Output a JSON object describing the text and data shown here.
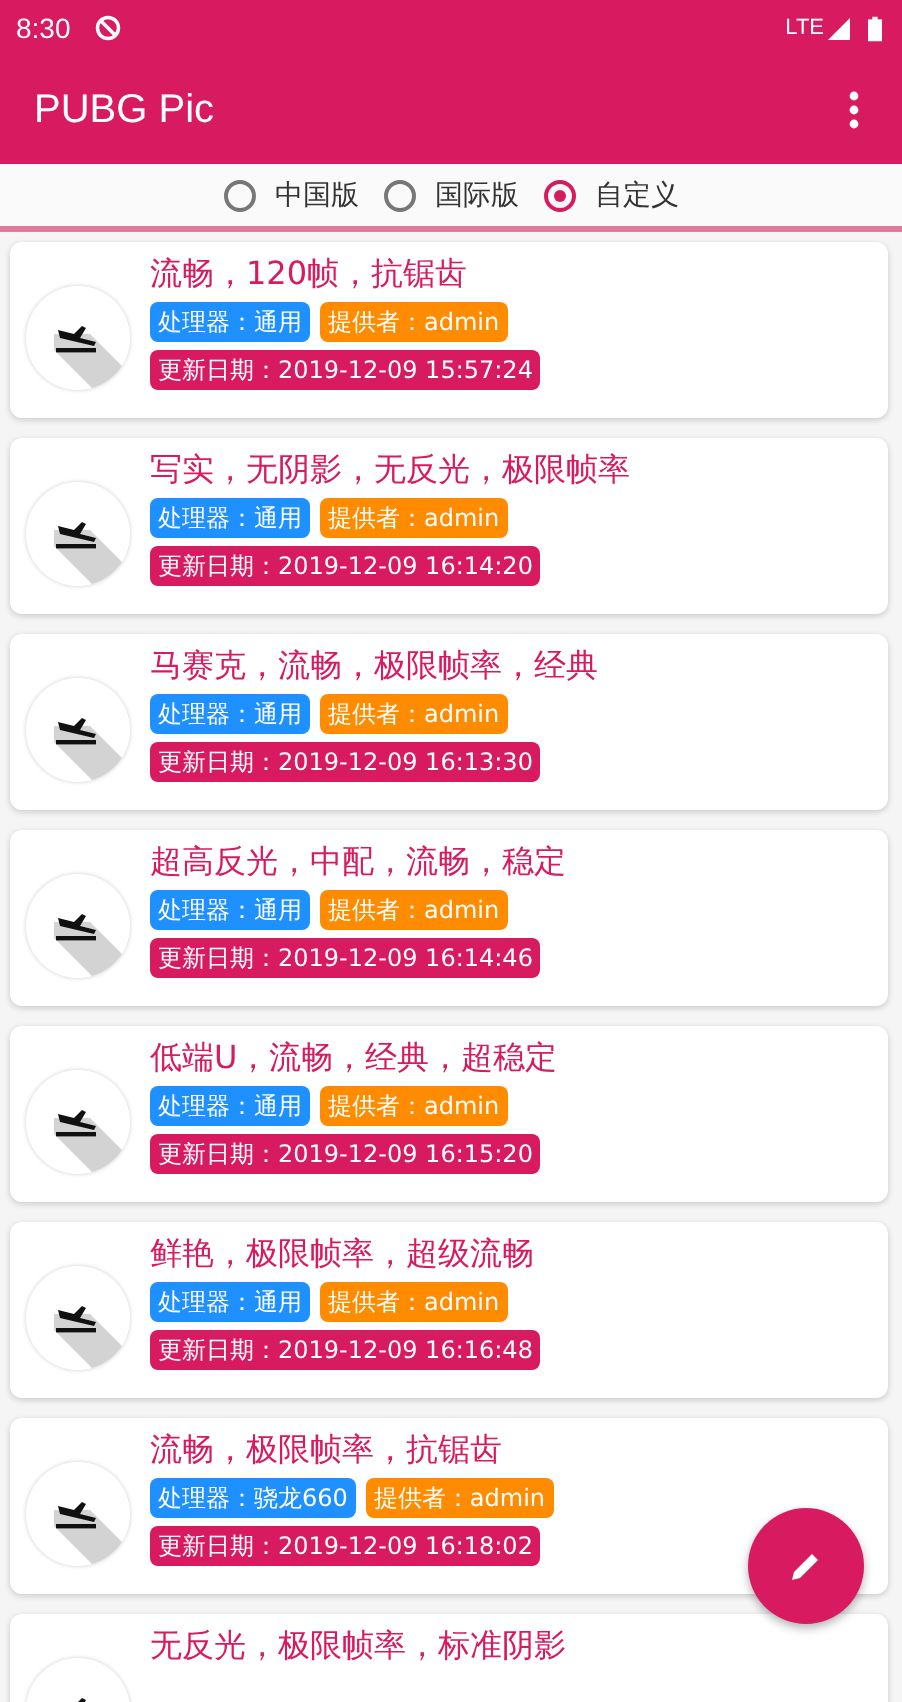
{
  "status_bar": {
    "time": "8:30",
    "network": "LTE"
  },
  "app_bar": {
    "title": "PUBG Pic"
  },
  "versions": [
    {
      "label": "中国版",
      "selected": false
    },
    {
      "label": "国际版",
      "selected": false
    },
    {
      "label": "自定义",
      "selected": true
    }
  ],
  "configs": [
    {
      "title": "流畅，120帧，抗锯齿",
      "processor": "处理器：通用",
      "provider": "提供者：admin",
      "updated": "更新日期：2019-12-09 15:57:24"
    },
    {
      "title": "写实，无阴影，无反光，极限帧率",
      "processor": "处理器：通用",
      "provider": "提供者：admin",
      "updated": "更新日期：2019-12-09 16:14:20"
    },
    {
      "title": "马赛克，流畅，极限帧率，经典",
      "processor": "处理器：通用",
      "provider": "提供者：admin",
      "updated": "更新日期：2019-12-09 16:13:30"
    },
    {
      "title": "超高反光，中配，流畅，稳定",
      "processor": "处理器：通用",
      "provider": "提供者：admin",
      "updated": "更新日期：2019-12-09 16:14:46"
    },
    {
      "title": "低端U，流畅，经典，超稳定",
      "processor": "处理器：通用",
      "provider": "提供者：admin",
      "updated": "更新日期：2019-12-09 16:15:20"
    },
    {
      "title": "鲜艳，极限帧率，超级流畅",
      "processor": "处理器：通用",
      "provider": "提供者：admin",
      "updated": "更新日期：2019-12-09 16:16:48"
    },
    {
      "title": "流畅，极限帧率，抗锯齿",
      "processor": "处理器：骁龙660",
      "provider": "提供者：admin",
      "updated": "更新日期：2019-12-09 16:18:02"
    },
    {
      "title": "无反光，极限帧率，标准阴影"
    }
  ]
}
